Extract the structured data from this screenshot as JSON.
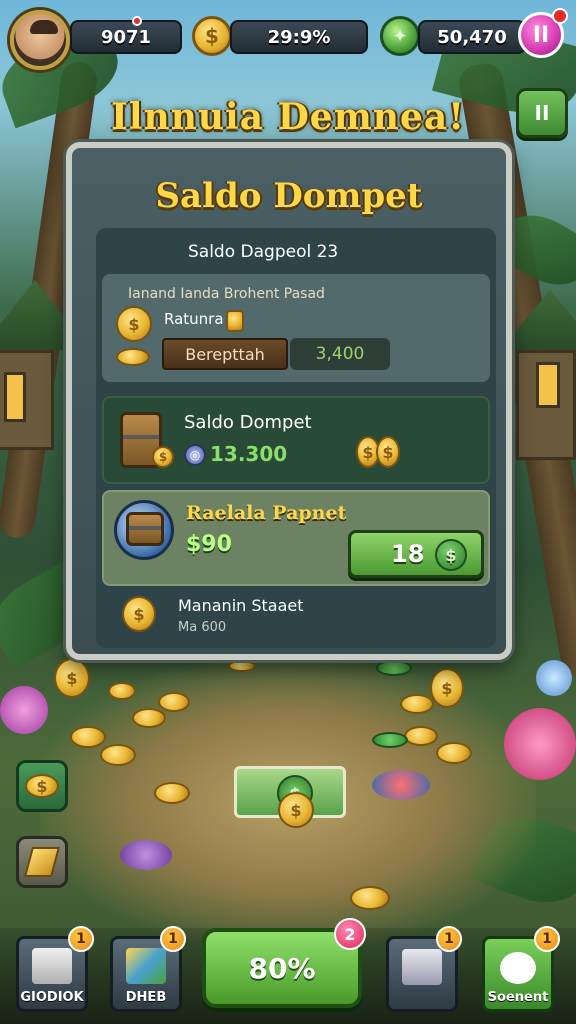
{
  "hud": {
    "player_value": "9071",
    "coins_value": "29:9%",
    "gems_value": "50,470",
    "pause_label": "II",
    "menu_label": "II"
  },
  "banner_title": "Ilnnuia Demnea!",
  "panel": {
    "title": "Saldo Dompet",
    "subtitle": "Saldo Dagpeol 23",
    "card_a": {
      "heading": "Ianand Ianda Brohent Pasad",
      "label": "Ratunra",
      "tag": "Berepttah",
      "amount": "3,400"
    },
    "card_b": {
      "title": "Saldo Dompet",
      "amount": "13.300"
    },
    "card_c": {
      "title": "Raelala Papnet",
      "price": "$90",
      "button_value": "18",
      "button_icon": "$"
    },
    "card_d": {
      "title": "Mananin Staaet",
      "value": "Ma 600"
    }
  },
  "bottom_nav": {
    "btn1": {
      "label": "GIODIOK",
      "badge": "1"
    },
    "btn2": {
      "label": "DHEB",
      "badge": "1"
    },
    "main": {
      "label": "80%",
      "badge": "2"
    },
    "btn4": {
      "badge": "1"
    },
    "btn5": {
      "label": "Soenent",
      "badge": "1"
    }
  },
  "colors": {
    "title_gold": "#ffd84a",
    "button_green": "#4a9a32",
    "panel_bg": "#3a4e52"
  }
}
